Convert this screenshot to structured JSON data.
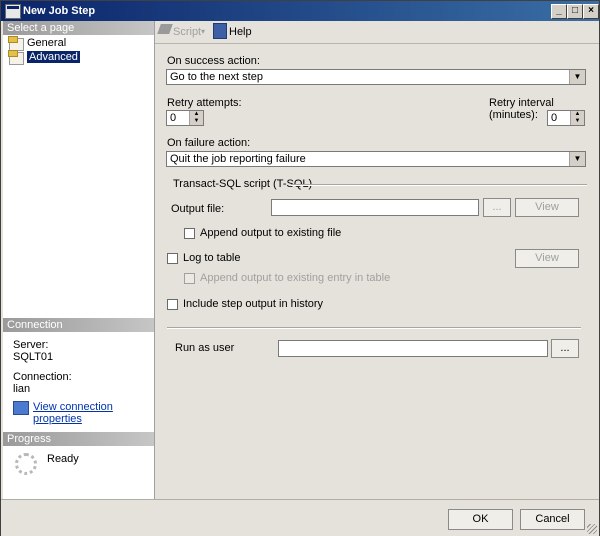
{
  "window": {
    "title": "New Job Step"
  },
  "sidebar": {
    "select_page_header": "Select a page",
    "pages": [
      {
        "label": "General",
        "selected": false
      },
      {
        "label": "Advanced",
        "selected": true
      }
    ],
    "connection_header": "Connection",
    "server_label": "Server:",
    "server_value": "SQLT01",
    "connection_label": "Connection:",
    "connection_value": "lian",
    "view_connection_link": "View connection properties",
    "progress_header": "Progress",
    "progress_status": "Ready"
  },
  "toolbar": {
    "script_label": "Script",
    "help_label": "Help"
  },
  "form": {
    "on_success_label": "On success action:",
    "on_success_value": "Go to the next step",
    "retry_attempts_label": "Retry attempts:",
    "retry_attempts_value": "0",
    "retry_interval_label": "Retry interval (minutes):",
    "retry_interval_value": "0",
    "on_failure_label": "On failure action:",
    "on_failure_value": "Quit the job reporting failure",
    "tsql_section_label": "Transact-SQL script (T-SQL)",
    "output_file_label": "Output file:",
    "output_file_value": "",
    "browse_label": "...",
    "view_label": "View",
    "append_output_label": "Append output to existing file",
    "log_to_table_label": "Log to table",
    "view_table_label": "View",
    "append_table_label": "Append output to existing entry in table",
    "include_history_label": "Include step output in history",
    "run_as_user_label": "Run as user",
    "run_as_user_value": "",
    "run_as_browse_label": "..."
  },
  "footer": {
    "ok_label": "OK",
    "cancel_label": "Cancel"
  }
}
